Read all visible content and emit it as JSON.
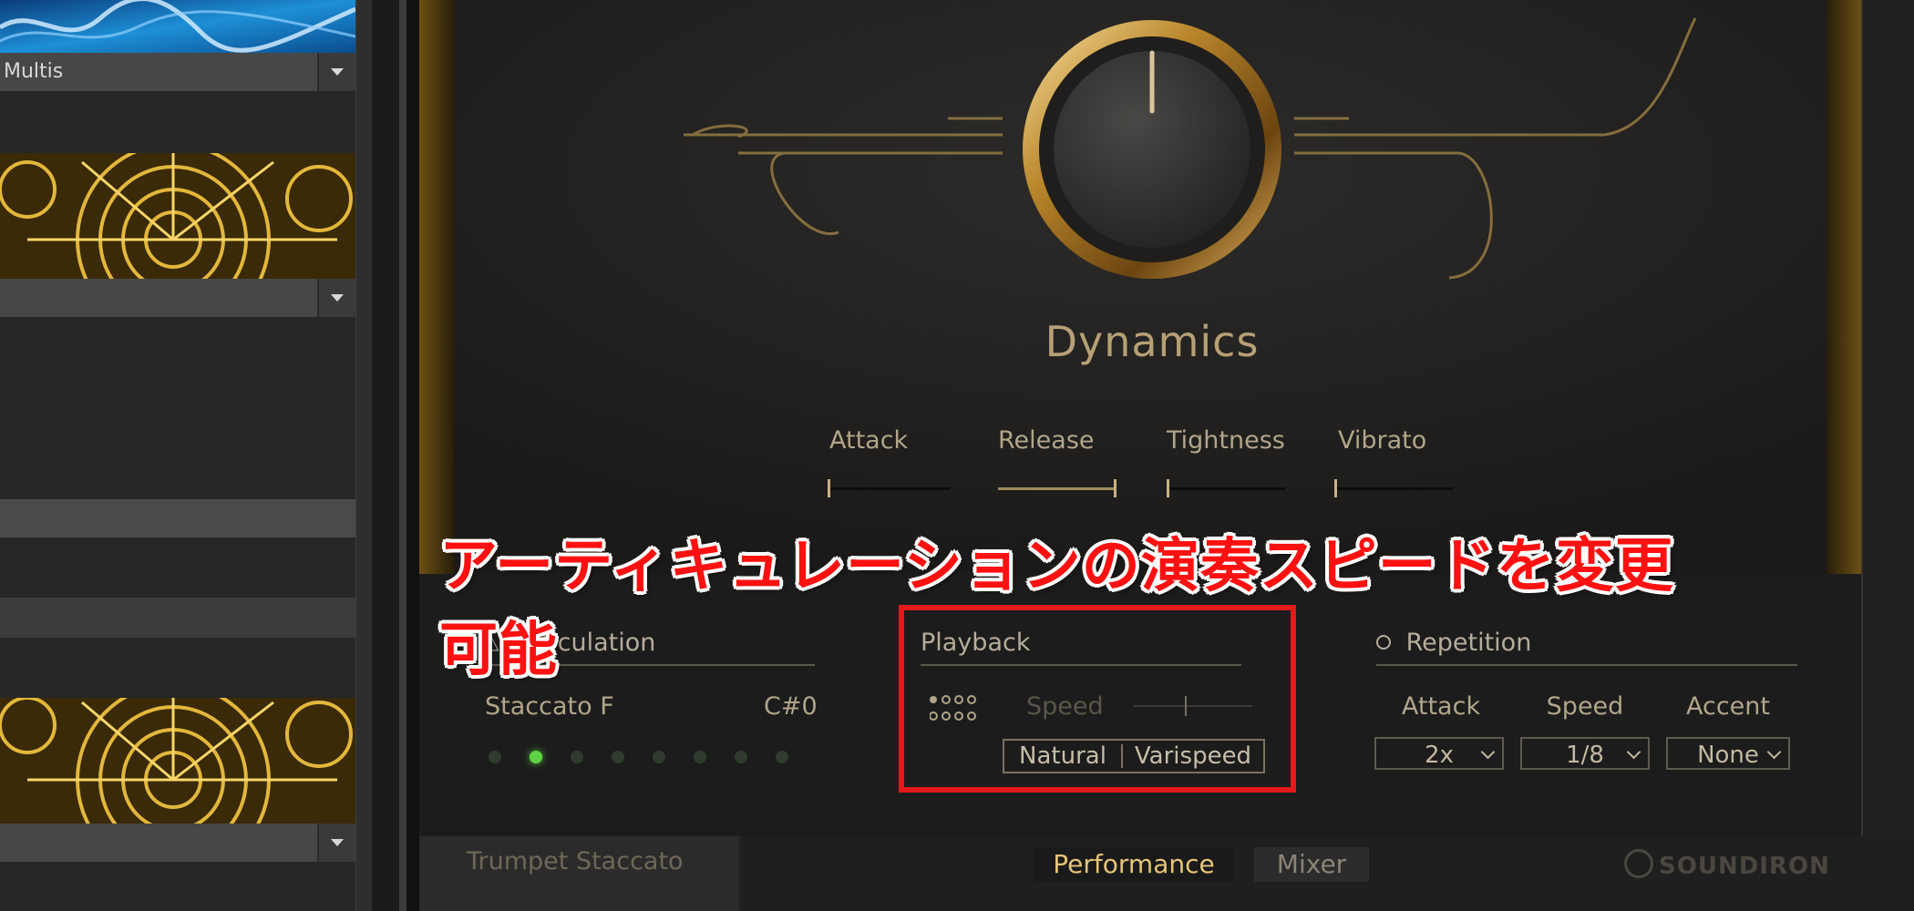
{
  "browser": {
    "multis_label": "Multis"
  },
  "dynamics": {
    "label": "Dynamics",
    "params": [
      {
        "name": "Attack",
        "value": 0.0
      },
      {
        "name": "Release",
        "value": 1.0
      },
      {
        "name": "Tightness",
        "value": 0.0
      },
      {
        "name": "Vibrato",
        "value": 0.0
      }
    ]
  },
  "annotation": {
    "caption": "アーティキュレーションの演奏スピードを変更可能",
    "highlight_color": "#e31a1a"
  },
  "articulation": {
    "title": "Articulation",
    "current": "Staccato F",
    "key": "C#0",
    "slot_count": 8,
    "active_slot": 2
  },
  "playback": {
    "title": "Playback",
    "speed_label": "Speed",
    "natural_label": "Natural",
    "varispeed_label": "Varispeed"
  },
  "repetition": {
    "title": "Repetition",
    "attack": {
      "label": "Attack",
      "value": "2x"
    },
    "speed": {
      "label": "Speed",
      "value": "1/8"
    },
    "accent": {
      "label": "Accent",
      "value": "None"
    }
  },
  "footer": {
    "instrument_name": "Trumpet Staccato",
    "tab_performance": "Performance",
    "tab_mixer": "Mixer",
    "brand": "SOUNDIRON"
  },
  "colors": {
    "gold": "#c9b184",
    "led_on": "#5ed445",
    "panel_bg": "#1c1c1c"
  }
}
